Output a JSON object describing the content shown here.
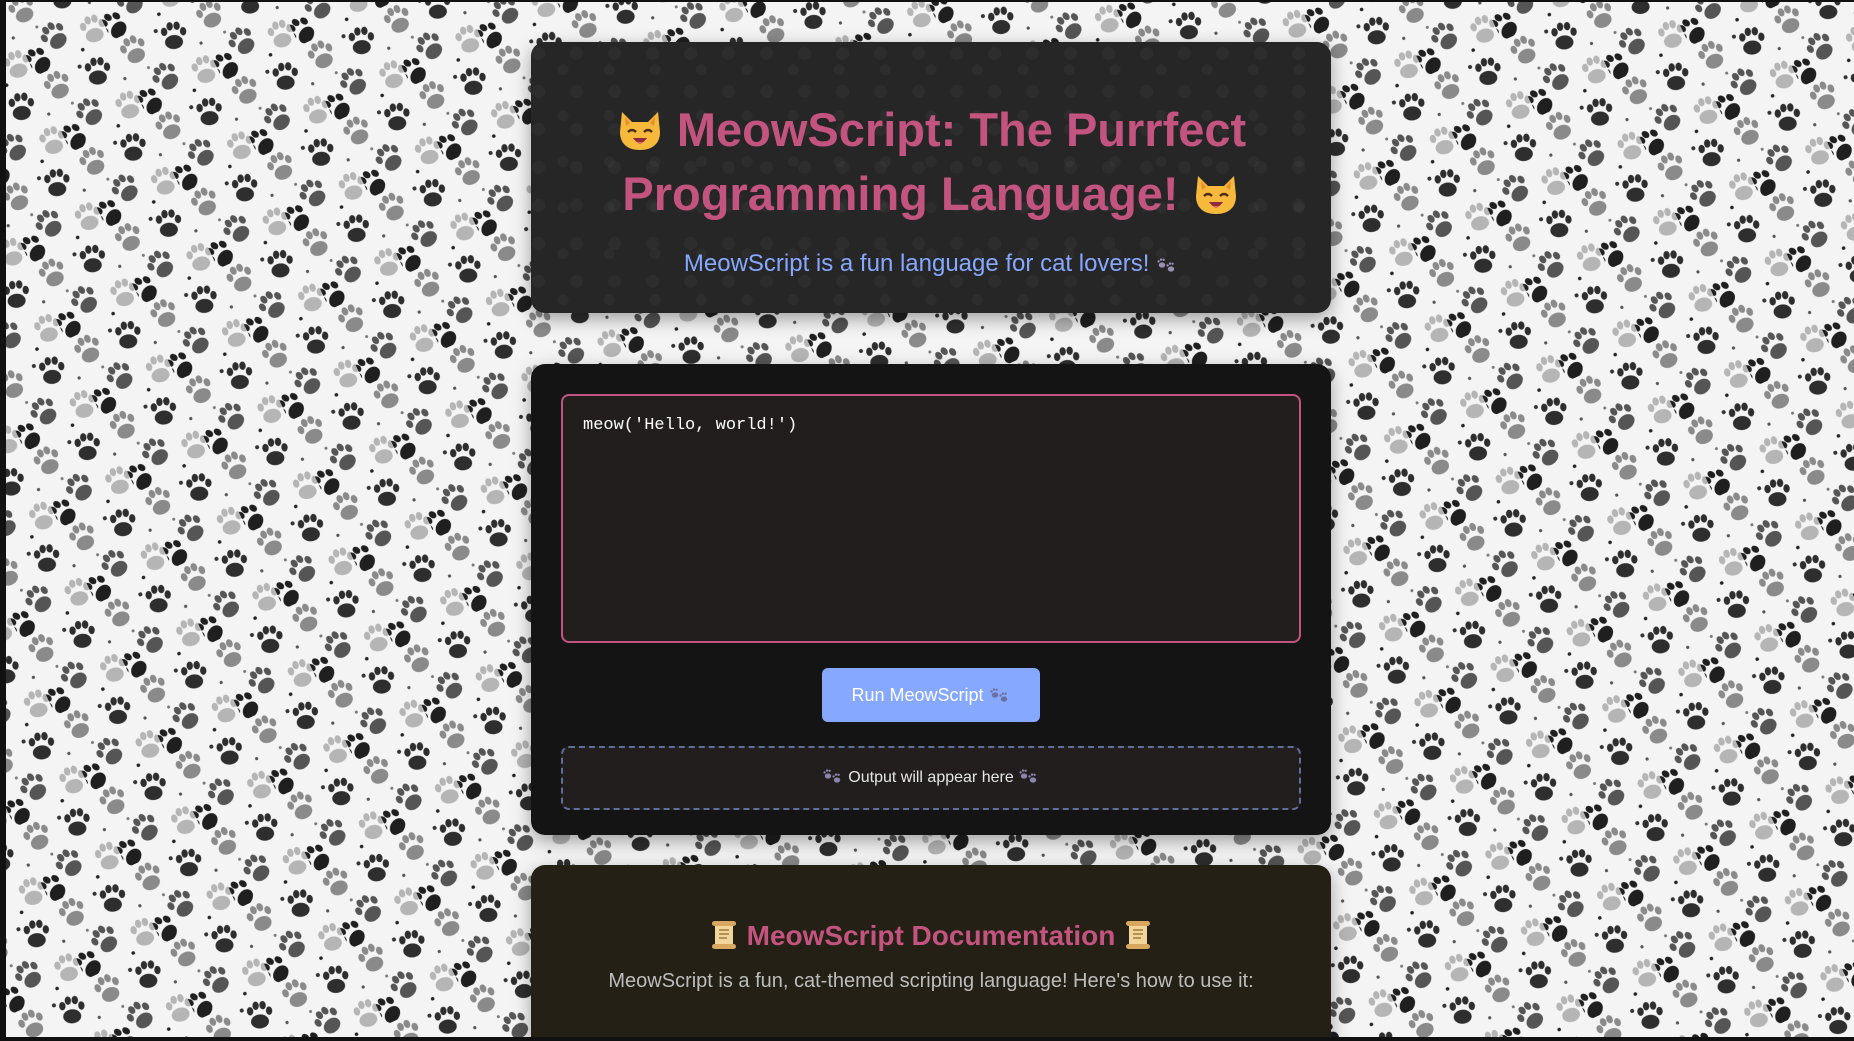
{
  "hero": {
    "title": "MeowScript: The Purrfect Programming Language!",
    "title_icon": "cat-face-emoji",
    "subtitle": "MeowScript is a fun language for cat lovers!",
    "subtitle_icon": "paw-prints-emoji"
  },
  "editor": {
    "code": "meow('Hello, world!')",
    "run_label": "Run MeowScript",
    "output_placeholder": "Output will appear here"
  },
  "docs": {
    "title": "MeowScript Documentation",
    "title_icon": "scroll-emoji",
    "intro": "MeowScript is a fun, cat-themed scripting language! Here's how to use it:"
  },
  "colors": {
    "accent_pink": "#c3547f",
    "accent_blue": "#86a8ff",
    "hero_bg": "#262626",
    "editor_bg": "#141414",
    "docs_bg": "#242015"
  }
}
